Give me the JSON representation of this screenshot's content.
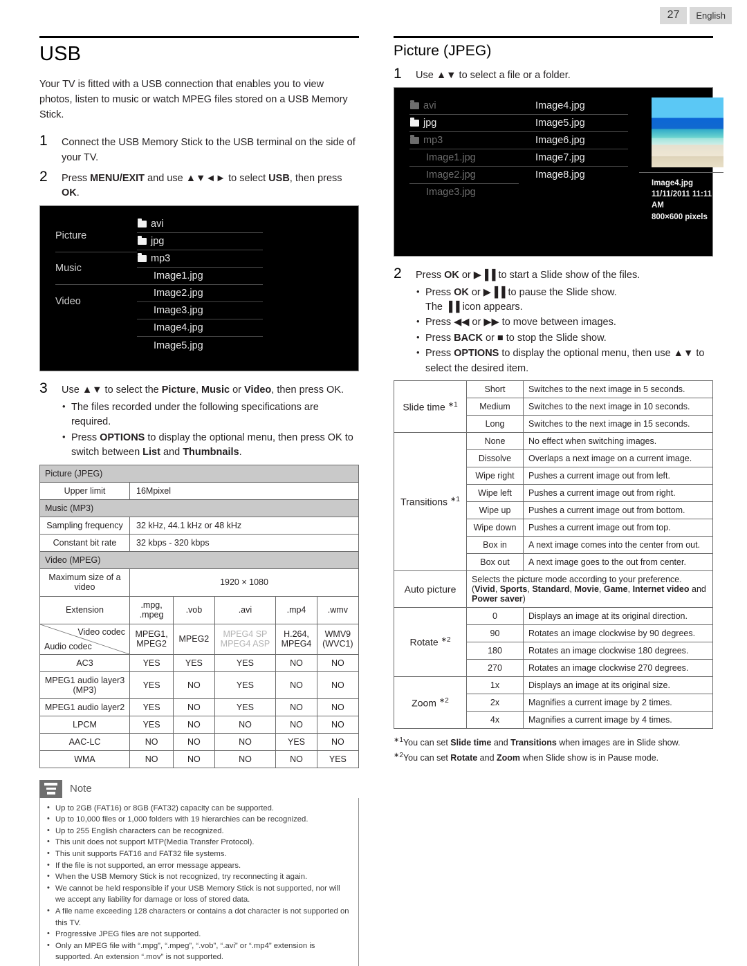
{
  "header": {
    "page_number": "27",
    "language": "English"
  },
  "left": {
    "title": "USB",
    "intro": "Your TV is fitted with a USB connection that enables you to view photos, listen to music or watch MPEG files stored on a USB Memory Stick.",
    "steps": [
      {
        "num": "1",
        "text": "Connect the USB Memory Stick to the USB terminal on the side of your TV."
      },
      {
        "num": "2",
        "text_html": "Press <b>MENU/EXIT</b> and use ▲▼◄► to select <b>USB</b>, then press <b>OK</b>."
      },
      {
        "num": "3",
        "text_html": "Use ▲▼ to select the <b>Picture</b>, <b>Music</b> or <b>Video</b>, then press OK."
      }
    ],
    "step3_bullets_html": [
      "The files recorded under the following specifications are required.",
      "Press <b>OPTIONS</b> to display the optional menu, then press OK to switch between <b>List</b> and <b>Thumbnails</b>."
    ],
    "tv_screen": {
      "categories": [
        "Picture",
        "Music",
        "Video"
      ],
      "files": [
        {
          "name": "avi",
          "type": "folder",
          "dim": false
        },
        {
          "name": "jpg",
          "type": "folder",
          "dim": false
        },
        {
          "name": "mp3",
          "type": "folder",
          "dim": false
        },
        {
          "name": "Image1.jpg",
          "type": "file",
          "dim": false
        },
        {
          "name": "Image2.jpg",
          "type": "file",
          "dim": false
        },
        {
          "name": "Image3.jpg",
          "type": "file",
          "dim": false
        },
        {
          "name": "Image4.jpg",
          "type": "file",
          "dim": false
        },
        {
          "name": "Image5.jpg",
          "type": "file",
          "dim": false
        }
      ]
    },
    "spec_table": {
      "picture_header": "Picture (JPEG)",
      "picture_rows": [
        {
          "label": "Upper limit",
          "value": "16Mpixel"
        }
      ],
      "music_header": "Music (MP3)",
      "music_rows": [
        {
          "label": "Sampling frequency",
          "value": "32 kHz, 44.1 kHz or 48 kHz"
        },
        {
          "label": "Constant bit rate",
          "value": "32 kbps - 320 kbps"
        }
      ],
      "video_header": "Video (MPEG)",
      "max_size_label": "Maximum size of a video",
      "max_size_value": "1920 × 1080",
      "extension_label": "Extension",
      "extensions": [
        ".mpg, .mpeg",
        ".vob",
        ".avi",
        ".mp4",
        ".wmv"
      ],
      "video_codec_label": "Video codec",
      "audio_codec_label": "Audio codec",
      "video_codecs": [
        {
          "text": "MPEG1, MPEG2",
          "dim": false
        },
        {
          "text": "MPEG2",
          "dim": false
        },
        {
          "text": "MPEG4 SP MPEG4 ASP",
          "dim": true
        },
        {
          "text": "H.264, MPEG4",
          "dim": false
        },
        {
          "text": "WMV9 (WVC1)",
          "dim": false
        }
      ],
      "audio_rows": [
        {
          "label": "AC3",
          "cells": [
            "YES",
            "YES",
            "YES",
            "NO",
            "NO"
          ]
        },
        {
          "label": "MPEG1 audio layer3 (MP3)",
          "cells": [
            "YES",
            "NO",
            "YES",
            "NO",
            "NO"
          ]
        },
        {
          "label": "MPEG1 audio layer2",
          "cells": [
            "YES",
            "NO",
            "YES",
            "NO",
            "NO"
          ]
        },
        {
          "label": "LPCM",
          "cells": [
            "YES",
            "NO",
            "NO",
            "NO",
            "NO"
          ]
        },
        {
          "label": "AAC-LC",
          "cells": [
            "NO",
            "NO",
            "NO",
            "YES",
            "NO"
          ]
        },
        {
          "label": "WMA",
          "cells": [
            "NO",
            "NO",
            "NO",
            "NO",
            "YES"
          ]
        }
      ]
    },
    "note": {
      "title": "Note",
      "items": [
        "Up to 2GB (FAT16) or 8GB (FAT32) capacity can be supported.",
        "Up to 10,000 files or 1,000 folders with 19 hierarchies can be recognized.",
        "Up to 255 English characters can be recognized.",
        "This unit does not support MTP(Media Transfer Protocol).",
        "This unit supports FAT16 and FAT32 file systems.",
        "If the file is not supported, an error message appears.",
        "When the USB Memory Stick is not recognized, try reconnecting it again.",
        "We cannot be held responsible if your USB Memory Stick is not supported, nor will we accept any liability for damage or loss of stored data.",
        "A file name exceeding 128 characters or contains a dot character is not supported on this TV.",
        "Progressive JPEG files are not supported.",
        "Only an MPEG file with “.mpg”, “.mpeg”, “.vob”, “.avi” or “.mp4” extension is supported. An extension “.mov” is not supported."
      ]
    }
  },
  "right": {
    "title": "Picture (JPEG)",
    "steps": [
      {
        "num": "1",
        "text_html": "Use ▲▼ to select a file or a folder."
      },
      {
        "num": "2",
        "text_html": "Press <b>OK</b> or ▶▐▐ to start a Slide show of the files."
      }
    ],
    "step2_bullets_html": [
      "Press <b>OK</b> or ▶▐▐ to pause the Slide show.<br>The ▐▐ icon appears.",
      "Press ◀◀ or ▶▶ to move between images.",
      "Press <b>BACK</b> or ■ to stop the Slide show.",
      "Press <b>OPTIONS</b> to display the optional menu, then use ▲▼ to select the desired item."
    ],
    "tv_screen": {
      "column_a": [
        {
          "name": "avi",
          "type": "folder",
          "dim": true
        },
        {
          "name": "jpg",
          "type": "folder",
          "dim": false
        },
        {
          "name": "mp3",
          "type": "folder",
          "dim": true
        },
        {
          "name": "Image1.jpg",
          "type": "file",
          "dim": true
        },
        {
          "name": "Image2.jpg",
          "type": "file",
          "dim": true
        },
        {
          "name": "Image3.jpg",
          "type": "file",
          "dim": true
        }
      ],
      "column_b": [
        {
          "name": "Image4.jpg",
          "type": "file",
          "dim": false
        },
        {
          "name": "Image5.jpg",
          "type": "file",
          "dim": false
        },
        {
          "name": "Image6.jpg",
          "type": "file",
          "dim": false
        },
        {
          "name": "Image7.jpg",
          "type": "file",
          "dim": false
        },
        {
          "name": "Image8.jpg",
          "type": "file",
          "dim": false
        }
      ],
      "preview": {
        "filename": "Image4.jpg",
        "timestamp": "11/11/2011 11:11 AM",
        "dimensions": "800×600 pixels"
      }
    },
    "options_table": [
      {
        "name": "Slide time",
        "star": "∗1",
        "rows": [
          {
            "value": "Short",
            "desc": "Switches to the next image in 5 seconds."
          },
          {
            "value": "Medium",
            "desc": "Switches to the next image in 10 seconds."
          },
          {
            "value": "Long",
            "desc": "Switches to the next image in 15 seconds."
          }
        ]
      },
      {
        "name": "Transitions",
        "star": "∗1",
        "rows": [
          {
            "value": "None",
            "desc": "No effect when switching images."
          },
          {
            "value": "Dissolve",
            "desc": "Overlaps a next image on a current image."
          },
          {
            "value": "Wipe right",
            "desc": "Pushes a current image out from left."
          },
          {
            "value": "Wipe left",
            "desc": "Pushes a current image out from right."
          },
          {
            "value": "Wipe up",
            "desc": "Pushes a current image out from bottom."
          },
          {
            "value": "Wipe down",
            "desc": "Pushes a current image out from top."
          },
          {
            "value": "Box in",
            "desc": "A next image comes into the center from out."
          },
          {
            "value": "Box out",
            "desc": "A next image goes to the out from center."
          }
        ]
      },
      {
        "name": "Auto picture",
        "star": "",
        "desc_html": "Selects the picture mode according to your preference. (<b>Vivid</b>, <b>Sports</b>, <b>Standard</b>, <b>Movie</b>, <b>Game</b>, <b>Internet video</b> and <b>Power saver</b>)",
        "rows": []
      },
      {
        "name": "Rotate",
        "star": "∗2",
        "rows": [
          {
            "value": "0",
            "desc": "Displays an image at its original direction."
          },
          {
            "value": "90",
            "desc": "Rotates an image clockwise by 90 degrees."
          },
          {
            "value": "180",
            "desc": "Rotates an image clockwise 180 degrees."
          },
          {
            "value": "270",
            "desc": "Rotates an image clockwise 270 degrees."
          }
        ]
      },
      {
        "name": "Zoom",
        "star": "∗2",
        "rows": [
          {
            "value": "1x",
            "desc": "Displays an image at its original size."
          },
          {
            "value": "2x",
            "desc": "Magnifies a current image by 2 times."
          },
          {
            "value": "4x",
            "desc": "Magnifies a current image by 4 times."
          }
        ]
      }
    ],
    "footnotes_html": [
      "<sup class=\"star\">∗1</sup>You can set <b>Slide time</b> and <b>Transitions</b> when images are in Slide show.",
      "<sup class=\"star\">∗2</sup>You can set <b>Rotate</b> and <b>Zoom</b> when Slide show is in Pause mode."
    ]
  }
}
